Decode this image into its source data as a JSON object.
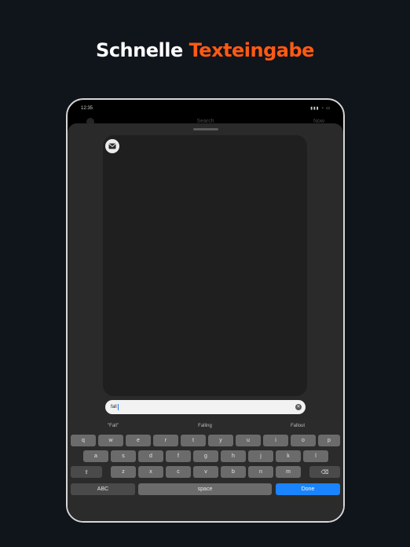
{
  "headline": {
    "word1": "Schnelle",
    "word2": "Texteingabe"
  },
  "status_bar": {
    "time": "12:35",
    "icons": "▮▮▮ ◔ ▭"
  },
  "background_nav": {
    "search": "Search",
    "right": "Now"
  },
  "input": {
    "value": "fall"
  },
  "suggestions": [
    "\"Fall\"",
    "Falling",
    "Fallout"
  ],
  "keyboard": {
    "row1": [
      "q",
      "w",
      "e",
      "r",
      "t",
      "y",
      "u",
      "i",
      "o",
      "p"
    ],
    "row2": [
      "a",
      "s",
      "d",
      "f",
      "g",
      "h",
      "j",
      "k",
      "l"
    ],
    "row3": [
      "z",
      "x",
      "c",
      "v",
      "b",
      "n",
      "m"
    ],
    "shift": "⇧",
    "delete": "⌫",
    "abc": "ABC",
    "space": "space",
    "done": "Done"
  },
  "colors": {
    "accent": "#ff5a14",
    "done_button": "#1a84ff",
    "background": "#10141b"
  }
}
